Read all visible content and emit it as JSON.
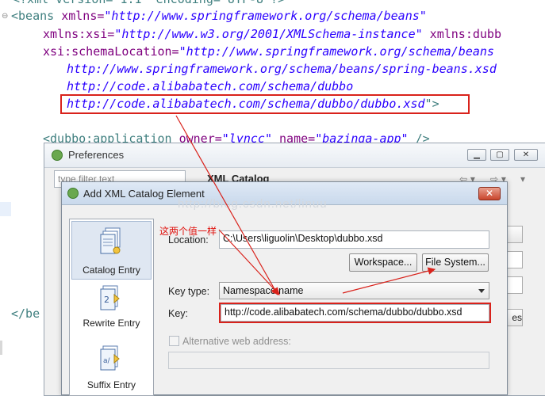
{
  "editor": {
    "lines": {
      "l0": "<?xml version=\"1.1\" encoding=\"UTF-8\"?>",
      "l1_tag": "<beans",
      "l1_attr": " xmlns=",
      "l1_val": "\"http://www.springframework.org/schema/beans\"",
      "l2_attr": "xmlns:xsi=",
      "l2_val": "\"http://www.w3.org/2001/XMLSchema-instance\"",
      "l2_attr2": " xmlns:dubb",
      "l3_attr": "xsi:schemaLocation=",
      "l3_val": "\"http://www.springframework.org/schema/beans",
      "l4_val": "http://www.springframework.org/schema/beans/spring-beans.xsd",
      "l5_val": "http://code.alibabatech.com/schema/dubbo",
      "l6_val": "http://code.alibabatech.com/schema/dubbo/dubbo.xsd",
      "l6_end": "\">",
      "l8_tag": "<dubbo:application",
      "l8_attr": " owner=",
      "l8_val": "\"lyncc\"",
      "l8_attr2": " name=",
      "l8_val2": "\"bazinga-app\"",
      "l8_end": " />",
      "end_tag": "</be"
    }
  },
  "preferences": {
    "title": "Preferences",
    "filter_placeholder": "type filter text",
    "heading": "XML Catalog",
    "nav_back": "⇦ ▾",
    "nav_forward": "⇨ ▾",
    "nav_menu": "▾",
    "side_btn_label": "es",
    "min_glyph": "▁",
    "max_glyph": "▢",
    "close_glyph": "✕"
  },
  "dialog": {
    "title": "Add XML Catalog Element",
    "close_glyph": "✕",
    "watermark": "http://blog.csdn.net/linuu",
    "annotation": "这两个值一样",
    "entries": [
      {
        "label": "Catalog Entry"
      },
      {
        "label": "Rewrite Entry"
      },
      {
        "label": "Suffix Entry"
      }
    ],
    "location_label": "Location:",
    "location_value": "C:\\Users\\liguolin\\Desktop\\dubbo.xsd",
    "workspace_btn": "Workspace...",
    "filesystem_btn": "File System...",
    "key_type_label": "Key type:",
    "key_type_value": "Namespace name",
    "key_label": "Key:",
    "key_value": "http://code.alibabatech.com/schema/dubbo/dubbo.xsd",
    "alt_web_label": "Alternative web address:",
    "alt_web_value": ""
  },
  "colors": {
    "highlight_red": "#d9221b",
    "annotation_red": "#e0130f"
  }
}
